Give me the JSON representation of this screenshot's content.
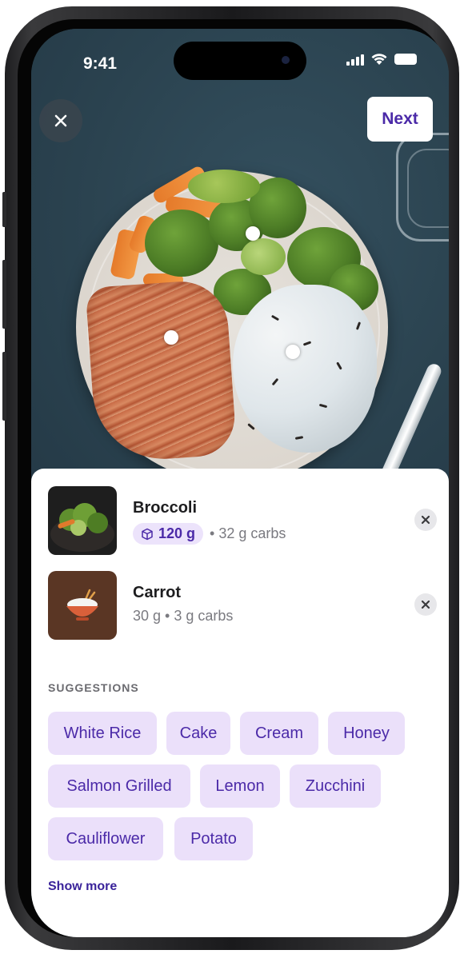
{
  "status_bar": {
    "time": "9:41"
  },
  "top_bar": {
    "close_icon": "close-icon",
    "next_label": "Next"
  },
  "detected_items": [
    {
      "name": "Broccoli",
      "weight": "120 g",
      "meta": "• 32 g carbs",
      "thumb_icon": "broccoli-thumbnail",
      "weight_icon": "cube-icon",
      "editable": true
    },
    {
      "name": "Carrot",
      "meta": "30 g • 3 g carbs",
      "thumb_icon": "rice-bowl-icon"
    }
  ],
  "suggestions": {
    "title": "SUGGESTIONS",
    "items": [
      "White Rice",
      "Cake",
      "Cream",
      "Honey",
      "Salmon Grilled",
      "Lemon",
      "Zucchini",
      "Cauliflower",
      "Potato"
    ],
    "show_more": "Show more"
  },
  "colors": {
    "accent": "#4b2aa8",
    "chip_bg": "#ebe0fa",
    "photo_bg": "#2d4653"
  }
}
